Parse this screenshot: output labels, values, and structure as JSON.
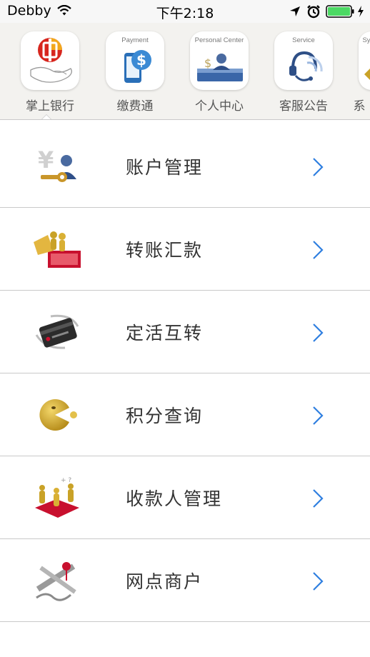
{
  "status_bar": {
    "carrier": "Debby",
    "time": "下午2:18",
    "icons": [
      "wifi-icon",
      "location-arrow-icon",
      "alarm-clock-icon",
      "battery-icon",
      "charging-bolt-icon"
    ],
    "battery_color": "#4cd964"
  },
  "categories": [
    {
      "label": "掌上银行",
      "caption": "",
      "icon": "bank-logo-hand-icon",
      "selected": true
    },
    {
      "label": "缴费通",
      "caption": "Payment",
      "icon": "phone-dollar-icon",
      "selected": false
    },
    {
      "label": "个人中心",
      "caption": "Personal Center",
      "icon": "person-desk-icon",
      "selected": false
    },
    {
      "label": "客服公告",
      "caption": "Service",
      "icon": "headset-icon",
      "selected": false
    },
    {
      "label": "系",
      "caption": "Sy",
      "icon": "partial-gold-icon",
      "selected": false
    }
  ],
  "menu": [
    {
      "label": "账户管理",
      "icon": "yuan-key-user-icon"
    },
    {
      "label": "转账汇款",
      "icon": "gold-people-transfer-icon"
    },
    {
      "label": "定活互转",
      "icon": "bank-card-rotate-icon"
    },
    {
      "label": "积分查询",
      "icon": "gold-pacman-icon"
    },
    {
      "label": "收款人管理",
      "icon": "payee-group-icon"
    },
    {
      "label": "网点商户",
      "icon": "map-pin-icon"
    }
  ],
  "colors": {
    "accent": "#2f7fe0",
    "gold": "#c9a227",
    "bank_red": "#c8102e"
  }
}
